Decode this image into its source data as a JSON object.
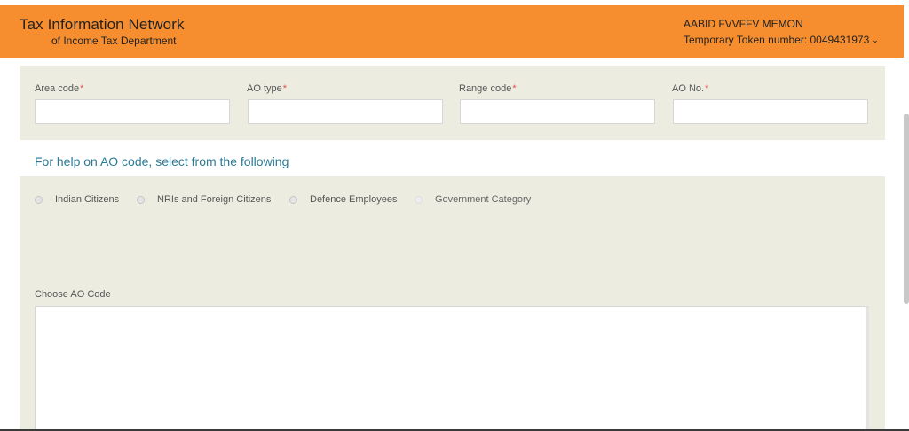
{
  "header": {
    "title": "Tax Information Network",
    "subtitle": "of Income Tax Department",
    "user_name": "AABID FVVFFV MEMON",
    "token_label": "Temporary Token number: 0049431973",
    "dropdown_icon": "chevron-down-icon",
    "background_color": "#f68e2f"
  },
  "ao_fields": [
    {
      "label": "Area code",
      "required_mark": "*",
      "value": ""
    },
    {
      "label": "AO type",
      "required_mark": "*",
      "value": ""
    },
    {
      "label": "Range code",
      "required_mark": "*",
      "value": ""
    },
    {
      "label": "AO No.",
      "required_mark": "*",
      "value": ""
    }
  ],
  "help": {
    "text": "For help on AO code, select from the following",
    "color": "#2b7a96"
  },
  "categories": [
    {
      "label": "Indian Citizens",
      "selected": false,
      "enabled": true
    },
    {
      "label": "NRIs and Foreign Citizens",
      "selected": false,
      "enabled": true
    },
    {
      "label": "Defence Employees",
      "selected": false,
      "enabled": true
    },
    {
      "label": "Government Category",
      "selected": false,
      "enabled": false
    }
  ],
  "choose": {
    "label": "Choose AO Code"
  },
  "panel_color": "#edece1"
}
